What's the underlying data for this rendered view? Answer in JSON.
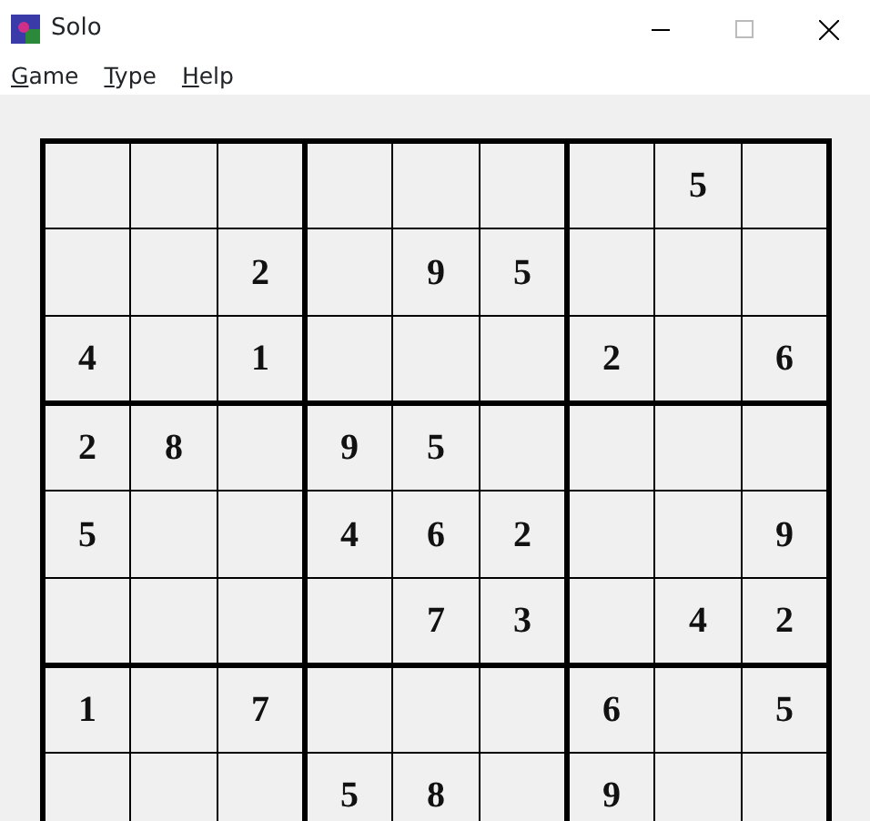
{
  "window": {
    "title": "Solo"
  },
  "menu": [
    "Game",
    "Type",
    "Help"
  ],
  "grid": {
    "rows": [
      [
        null,
        null,
        null,
        null,
        null,
        null,
        null,
        "5",
        null
      ],
      [
        null,
        null,
        "2",
        null,
        "9",
        "5",
        null,
        null,
        null
      ],
      [
        "4",
        null,
        "1",
        null,
        null,
        null,
        "2",
        null,
        "6"
      ],
      [
        "2",
        "8",
        null,
        "9",
        "5",
        null,
        null,
        null,
        null
      ],
      [
        "5",
        null,
        null,
        "4",
        "6",
        "2",
        null,
        null,
        "9"
      ],
      [
        null,
        null,
        null,
        null,
        "7",
        "3",
        null,
        "4",
        "2"
      ],
      [
        "1",
        null,
        "7",
        null,
        null,
        null,
        "6",
        null,
        "5"
      ],
      [
        null,
        null,
        null,
        "5",
        "8",
        null,
        "9",
        null,
        null
      ]
    ]
  }
}
